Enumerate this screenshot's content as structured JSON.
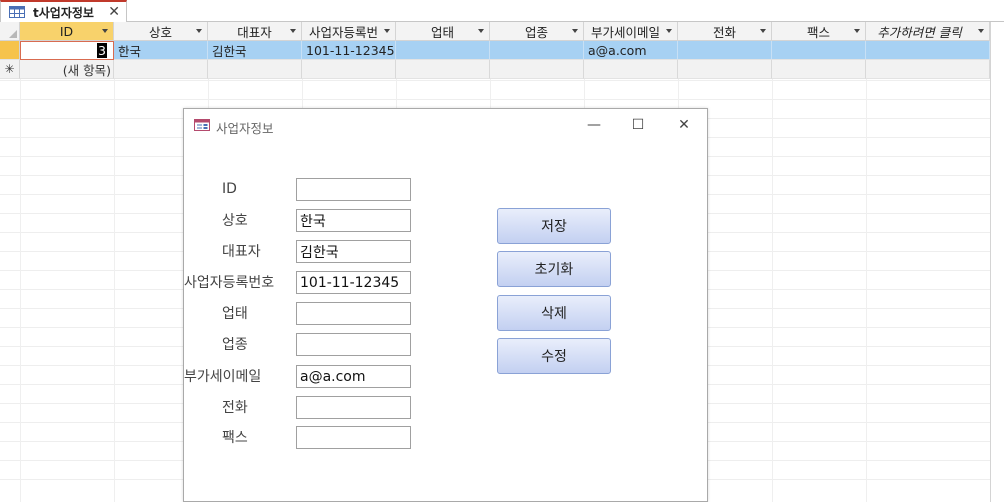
{
  "tab": {
    "label": "t사업자정보",
    "close": "✕"
  },
  "grid": {
    "columns": [
      {
        "label": "ID"
      },
      {
        "label": "상호"
      },
      {
        "label": "대표자"
      },
      {
        "label": "사업자등록번"
      },
      {
        "label": "업태"
      },
      {
        "label": "업종"
      },
      {
        "label": "부가세이메일"
      },
      {
        "label": "전화"
      },
      {
        "label": "팩스"
      },
      {
        "label": "추가하려면 클릭"
      }
    ],
    "rows": [
      {
        "id": "3",
        "cells": [
          "한국",
          "김한국",
          "101-11-12345",
          "",
          "",
          "a@a.com",
          "",
          "",
          ""
        ]
      }
    ],
    "new_row_marker": "✳",
    "new_row_label": "(새 항목)"
  },
  "form": {
    "title": "사업자정보",
    "window_buttons": {
      "minimize": "—",
      "maximize": "☐",
      "close": "✕"
    },
    "fields": [
      {
        "label": "ID",
        "value": ""
      },
      {
        "label": "상호",
        "value": "한국"
      },
      {
        "label": "대표자",
        "value": "김한국"
      },
      {
        "label": "사업자등록번호",
        "value": "101-11-12345"
      },
      {
        "label": "업태",
        "value": ""
      },
      {
        "label": "업종",
        "value": ""
      },
      {
        "label": "부가세이메일",
        "value": "a@a.com"
      },
      {
        "label": "전화",
        "value": ""
      },
      {
        "label": "팩스",
        "value": ""
      }
    ],
    "buttons": [
      {
        "label": "저장"
      },
      {
        "label": "초기화"
      },
      {
        "label": "삭제"
      },
      {
        "label": "수정"
      }
    ]
  }
}
